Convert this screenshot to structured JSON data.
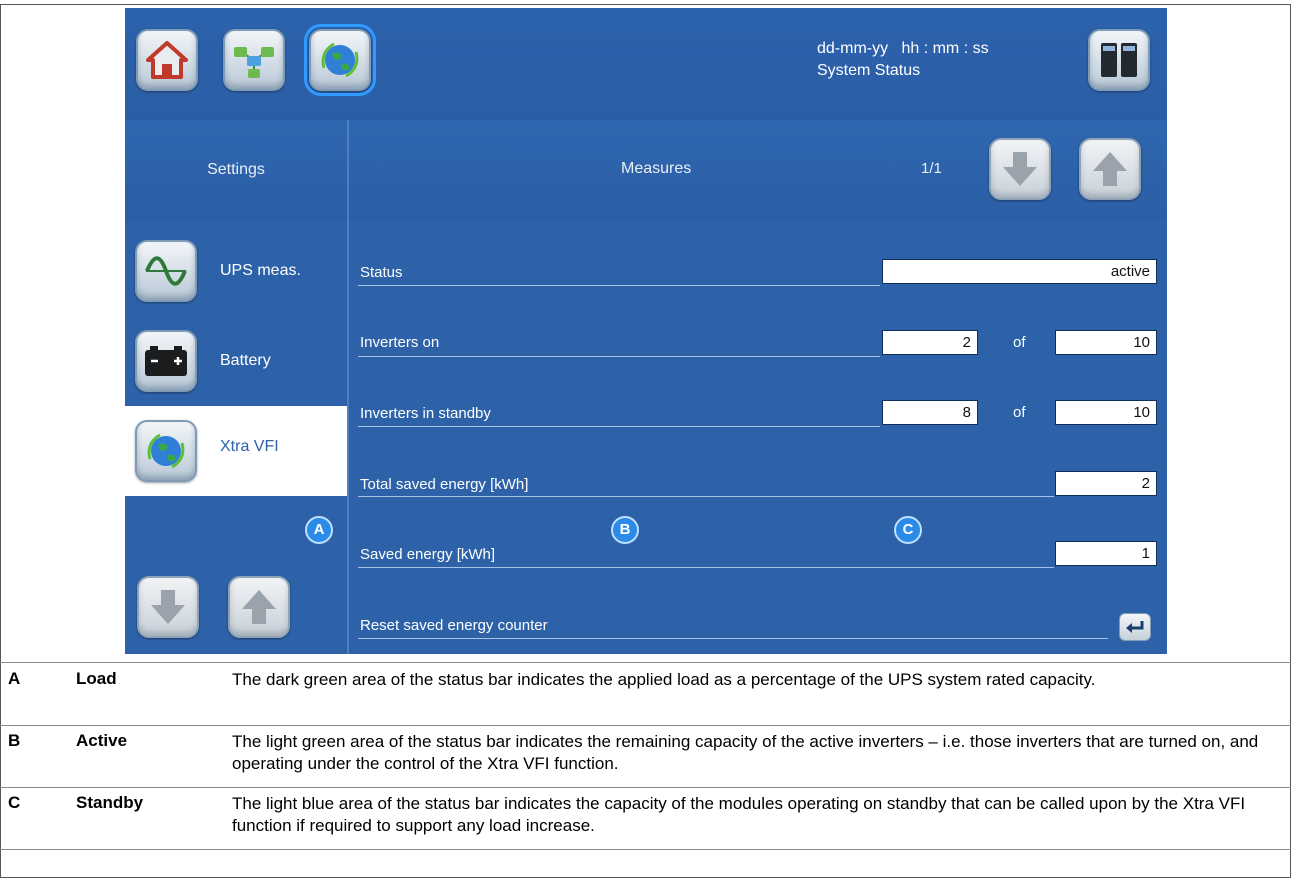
{
  "header": {
    "date": "dd-mm-yy",
    "time": "hh : mm : ss",
    "status": "System Status",
    "buttons": [
      "home-icon",
      "network-icon",
      "xtra-vfi-icon",
      "ups-cabinet-icon"
    ]
  },
  "panel": {
    "settings_label": "Settings",
    "measures_label": "Measures",
    "page_indicator": "1/1"
  },
  "sidebar": {
    "items": [
      {
        "label": "UPS meas.",
        "icon": "sine-wave-icon"
      },
      {
        "label": "Battery",
        "icon": "battery-icon"
      },
      {
        "label": "Xtra VFI",
        "icon": "globe-leaf-icon",
        "active": true
      }
    ]
  },
  "measures": {
    "status": {
      "label": "Status",
      "value": "active"
    },
    "inverters_on": {
      "label": "Inverters on",
      "value": "2",
      "of_label": "of",
      "total": "10"
    },
    "inverters_standby": {
      "label": "Inverters in standby",
      "value": "8",
      "of_label": "of",
      "total": "10"
    },
    "total_saved": {
      "label": "Total saved energy [kWh]",
      "value": "2"
    },
    "saved": {
      "label": "Saved energy [kWh]",
      "value": "1"
    },
    "reset": {
      "label": "Reset saved energy counter"
    }
  },
  "markers": [
    "A",
    "B",
    "C"
  ],
  "legend": [
    {
      "letter": "A",
      "term": "Load",
      "text": "The dark green area of the status bar indicates the applied load as a percentage of the UPS system rated capacity."
    },
    {
      "letter": "B",
      "term": "Active",
      "text": "The light green area of the status bar indicates the remaining capacity of the active inverters – i.e. those inverters that are turned on, and operating under the control of the Xtra VFI function."
    },
    {
      "letter": "C",
      "term": "Standby",
      "text": "The light blue area of the status bar indicates the capacity of the modules operating on standby that can be called upon by the Xtra VFI function if required to support any load increase."
    }
  ],
  "colors": {
    "screen_bg": "#2d62a8",
    "marker": "#2a8be8"
  }
}
